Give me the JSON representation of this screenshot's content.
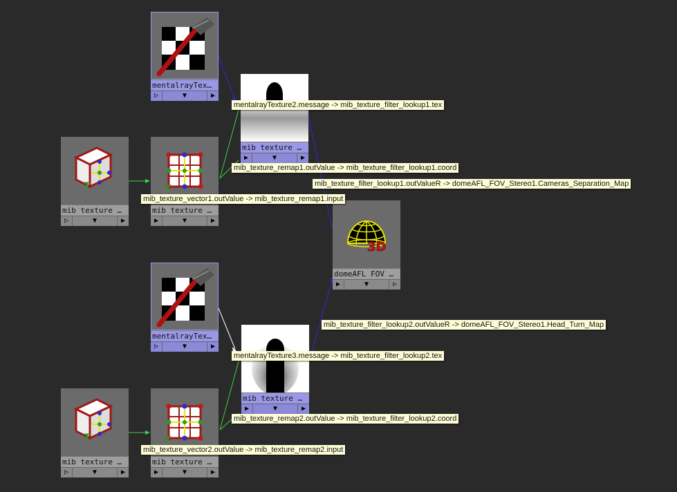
{
  "nodes": {
    "tex2": {
      "label": "mentalrayTex…",
      "icon": "checker-brush-icon"
    },
    "filter1": {
      "label": "mib texture …",
      "icon": "gradient-preview-icon"
    },
    "vec1": {
      "label": "mib texture …",
      "icon": "cube-axes-icon"
    },
    "remap1": {
      "label": "mib texture …",
      "icon": "grid-remap-icon"
    },
    "dome": {
      "label": "domeAFL FOV …",
      "icon": "dome-3d-icon"
    },
    "tex3": {
      "label": "mentalrayTex…",
      "icon": "checker-brush-icon"
    },
    "filter2": {
      "label": "mib texture …",
      "icon": "gradient-preview-icon"
    },
    "vec2": {
      "label": "mib texture …",
      "icon": "cube-axes-icon"
    },
    "remap2": {
      "label": "mib texture …",
      "icon": "grid-remap-icon"
    }
  },
  "controls": {
    "left": "▷",
    "mid": "▼",
    "right": "▶"
  },
  "tooltips": {
    "t1": "mentalrayTexture2.message -> mib_texture_filter_lookup1.tex",
    "t2": "mib_texture_remap1.outValue -> mib_texture_filter_lookup1.coord",
    "t3": "mib_texture_filter_lookup1.outValueR -> domeAFL_FOV_Stereo1.Cameras_Separation_Map",
    "t4": "mib_texture_vector1.outValue -> mib_texture_remap1.input",
    "t5": "mib_texture_filter_lookup2.outValueR -> domeAFL_FOV_Stereo1.Head_Turn_Map",
    "t6": "mentalrayTexture3.message -> mib_texture_filter_lookup2.tex",
    "t7": "mib_texture_remap2.outValue -> mib_texture_filter_lookup2.coord",
    "t8": "mib_texture_vector2.outValue -> mib_texture_remap2.input"
  },
  "colors": {
    "background": "#2a2a2a",
    "wire_message": "#ffffff",
    "wire_vector": "#3fd13f",
    "wire_scalar": "#2b2bd6",
    "selected_node": "#9a98e6"
  }
}
